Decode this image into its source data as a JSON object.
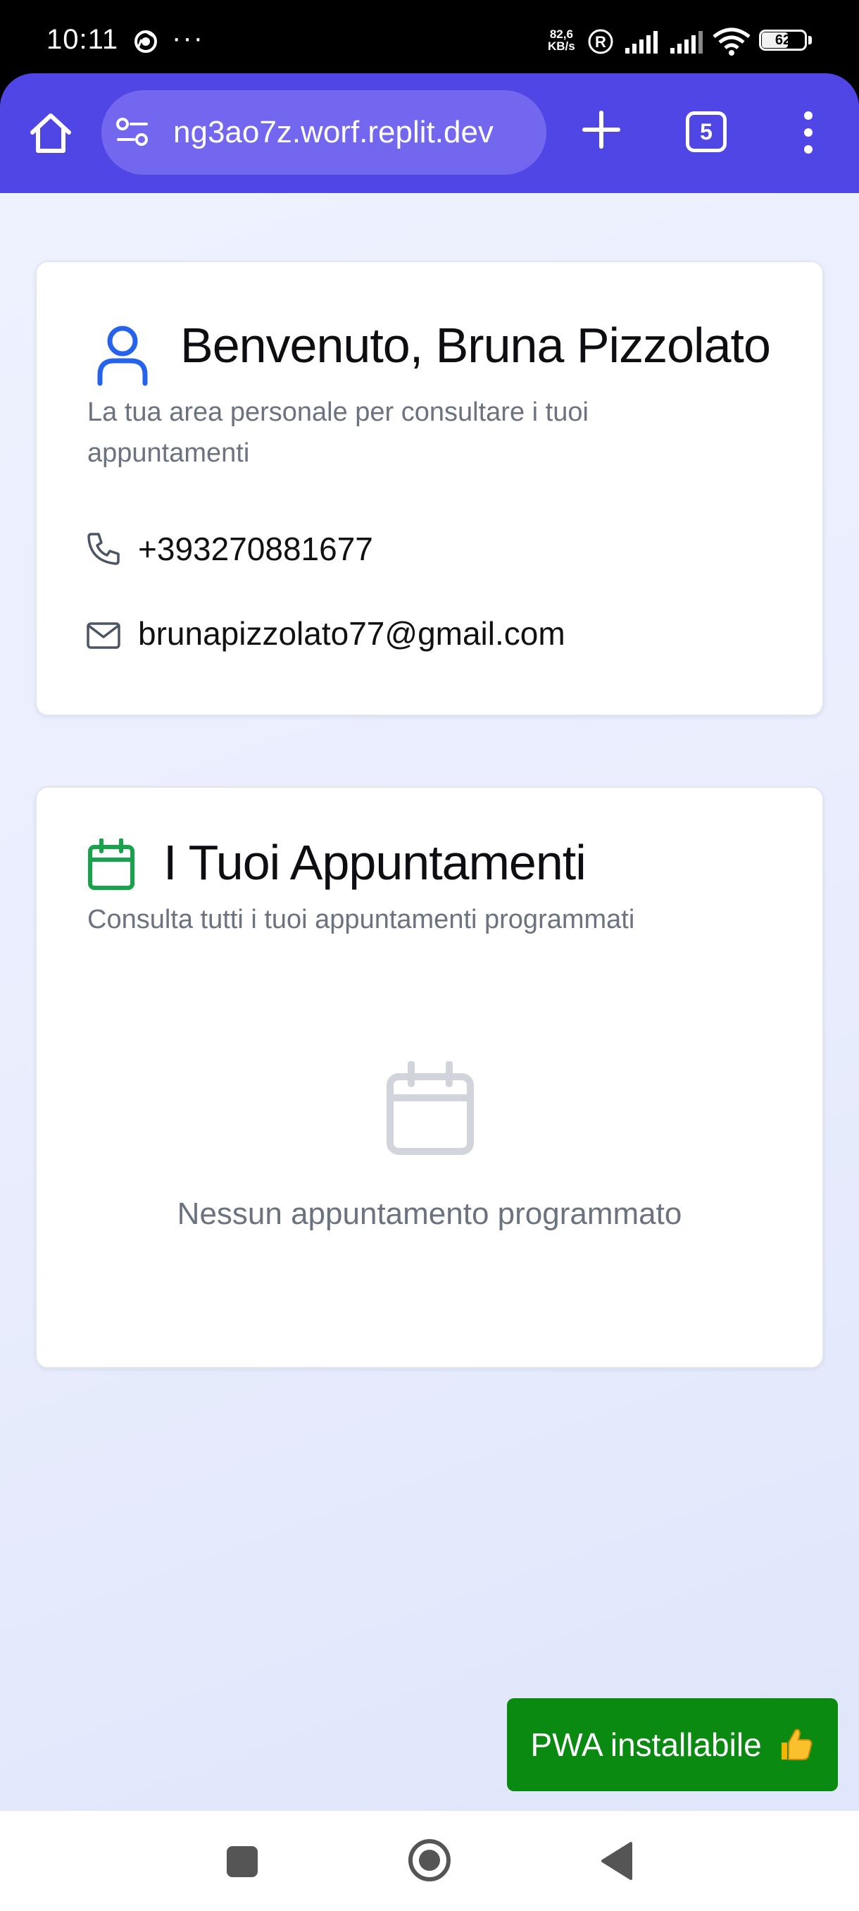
{
  "status_bar": {
    "time": "10:11",
    "more_indicator": "···",
    "net_speed_value": "82,6",
    "net_speed_unit": "KB/s",
    "battery_level": "62",
    "icons": [
      "chrome-icon",
      "registered-icon",
      "signal-icon",
      "signal-icon",
      "wifi-icon",
      "battery-icon"
    ]
  },
  "browser": {
    "url": "ng3ao7z.worf.replit.dev",
    "tab_count": "5",
    "theme_color": "#5046e5",
    "icons": [
      "home-icon",
      "site-settings-icon",
      "new-tab-icon",
      "tab-switcher-icon",
      "more-menu-icon"
    ]
  },
  "profile": {
    "title": "Benvenuto, Bruna Pizzolato",
    "subtitle": "La tua area personale per consultare i tuoi appuntamenti",
    "phone": "+393270881677",
    "email": "brunapizzolato77@gmail.com",
    "icons": [
      "user-icon",
      "phone-icon",
      "mail-icon"
    ],
    "accent_color": "#2563eb"
  },
  "appointments": {
    "title": "I Tuoi Appuntamenti",
    "subtitle": "Consulta tutti i tuoi appuntamenti programmati",
    "empty_message": "Nessun appuntamento programmato",
    "icons": [
      "calendar-icon",
      "empty-calendar-icon"
    ],
    "accent_color": "#16a34a"
  },
  "pwa_badge": {
    "label": "PWA installabile",
    "icon": "thumbs-up-icon",
    "color": "#0b8a12"
  },
  "nav_bar": {
    "icons": [
      "recents-icon",
      "home-circle-icon",
      "back-icon"
    ]
  }
}
